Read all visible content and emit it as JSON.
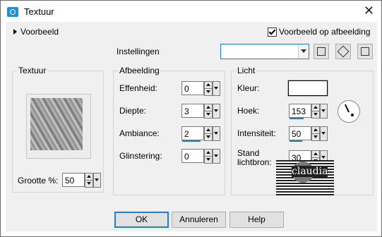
{
  "window": {
    "title": "Textuur",
    "close_glyph": "✕"
  },
  "top": {
    "preview_toggle": "Voorbeeld",
    "preview_on_image": "Voorbeeld op afbeelding",
    "preview_on_image_checked": true,
    "settings_label": "Instellingen",
    "settings_value": "",
    "tool_icons": [
      "save-preset-icon",
      "random-dice-icon",
      "reset-icon"
    ]
  },
  "texture": {
    "title": "Textuur",
    "size_label": "Grootte %:",
    "size_value": "50"
  },
  "image": {
    "title": "Afbeelding",
    "fields": [
      {
        "label": "Effenheid:",
        "value": "0"
      },
      {
        "label": "Diepte:",
        "value": "3"
      },
      {
        "label": "Ambiance:",
        "value": "2"
      },
      {
        "label": "Glinstering:",
        "value": "0"
      }
    ]
  },
  "light": {
    "title": "Licht",
    "color_label": "Kleur:",
    "color_value": "#ffffff",
    "angle_label": "Hoek:",
    "angle_value": "153",
    "intensity_label": "Intensiteit:",
    "intensity_value": "50",
    "elevation_label_1": "Stand",
    "elevation_label_2": "lichtbron:",
    "elevation_value": "30"
  },
  "watermark": {
    "text": "claudia"
  },
  "buttons": {
    "ok": "OK",
    "cancel": "Annuleren",
    "help": "Help"
  }
}
